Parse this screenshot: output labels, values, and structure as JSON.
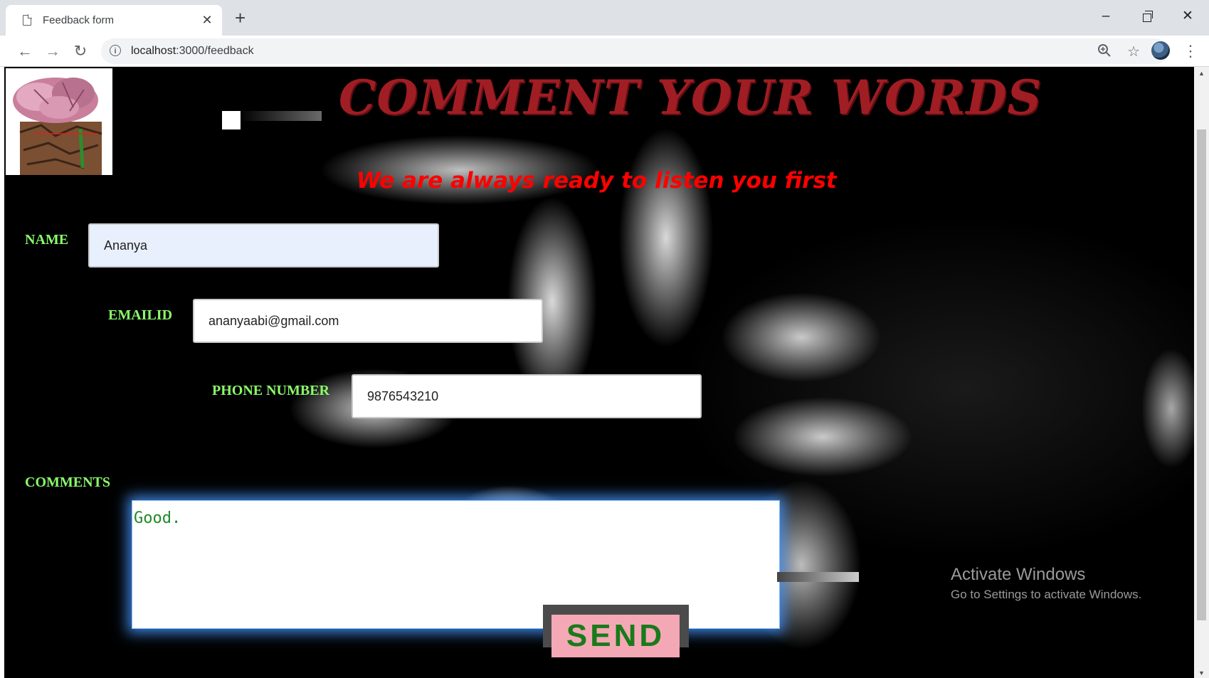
{
  "browser": {
    "tab_title": "Feedback form",
    "url_host": "localhost",
    "url_rest": ":3000/feedback"
  },
  "page": {
    "heading": "COMMENT YOUR WORDS",
    "subheading": "We are always ready to listen you first",
    "name_label": "NAME",
    "name_value": "Ananya",
    "email_label": "EMAILID",
    "email_value": "ananyaabi@gmail.com",
    "phone_label": "PHONE NUMBER",
    "phone_value": "9876543210",
    "comments_label": "COMMENTS",
    "comments_value": "Good.",
    "send_label": "SEND"
  },
  "watermark": {
    "line1": "Activate Windows",
    "line2": "Go to Settings to activate Windows."
  },
  "colors": {
    "heading": "#a11d24",
    "subheading": "#ff0000",
    "labels": "#8aff6a",
    "send_bg": "#f4a8b6",
    "send_text": "#1a7a1a"
  },
  "icons": [
    "document-icon",
    "close-icon",
    "plus-icon",
    "minimize-icon",
    "restore-icon",
    "window-close-icon",
    "back-arrow-icon",
    "forward-arrow-icon",
    "reload-icon",
    "info-icon",
    "zoom-icon",
    "star-icon",
    "avatar",
    "kebab-menu-icon"
  ]
}
